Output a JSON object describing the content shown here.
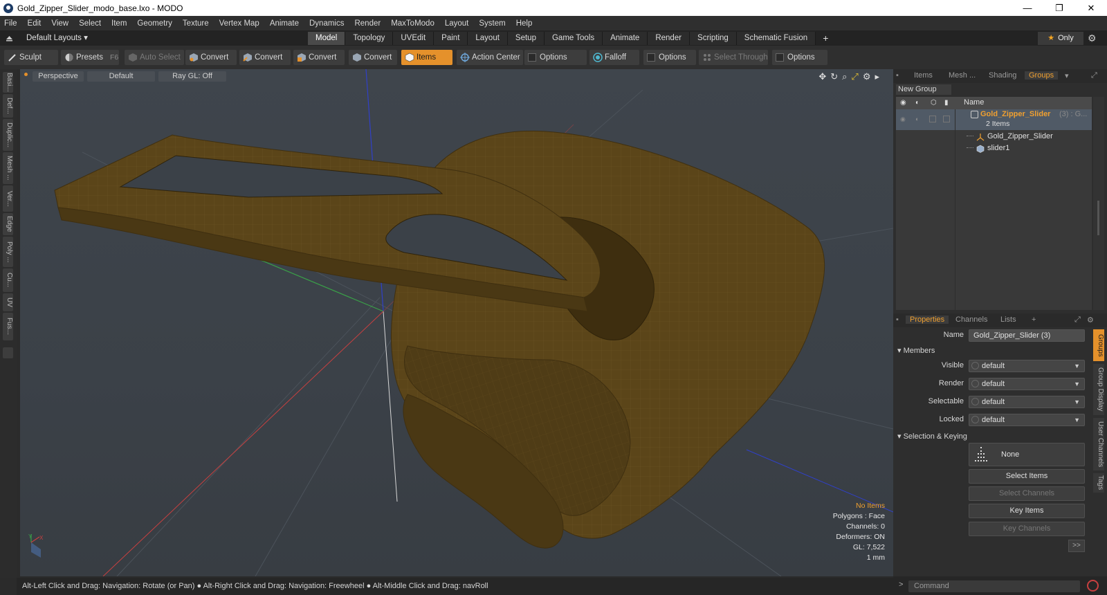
{
  "window": {
    "title": "Gold_Zipper_Slider_modo_base.lxo - MODO",
    "min": "—",
    "max": "❐",
    "close": "✕"
  },
  "menu": [
    "File",
    "Edit",
    "View",
    "Select",
    "Item",
    "Geometry",
    "Texture",
    "Vertex Map",
    "Animate",
    "Dynamics",
    "Render",
    "MaxToModo",
    "Layout",
    "System",
    "Help"
  ],
  "layout": {
    "selector": "Default Layouts ▾",
    "tabs": [
      "Model",
      "Topology",
      "UVEdit",
      "Paint",
      "Layout",
      "Setup",
      "Game Tools",
      "Animate",
      "Render",
      "Scripting",
      "Schematic Fusion"
    ],
    "active_tab": "Model",
    "plus": "+",
    "only": "Only"
  },
  "toolbar": {
    "sculpt": "Sculpt",
    "presets": "Presets",
    "presets_key": "F6",
    "auto_select": "Auto Select",
    "convert1": "Convert",
    "convert2": "Convert",
    "convert3": "Convert",
    "convert4": "Convert",
    "items": "Items",
    "action_center": "Action Center",
    "options1": "Options",
    "falloff": "Falloff",
    "options2": "Options",
    "select_through": "Select Through",
    "options3": "Options"
  },
  "left_tabs": [
    "Basi...",
    "Def...",
    "Duplic...",
    "Mesh ...",
    "Ver...",
    "Edge",
    "Poly ...",
    "Cu...",
    "UV",
    "Fus..."
  ],
  "viewport": {
    "view": "Perspective",
    "shading": "Default",
    "raygl": "Ray GL: Off",
    "info": {
      "no_items": "No Items",
      "polygons": "Polygons : Face",
      "channels": "Channels: 0",
      "deformers": "Deformers: ON",
      "gl": "GL: 7,522",
      "unit": "1 mm"
    },
    "colors": {
      "model": "#5b4519",
      "wire": "#6d5525",
      "x_axis": "#c84040",
      "y_axis": "#3aa048",
      "z_axis": "#3040c8"
    }
  },
  "status": "Alt-Left Click and Drag: Navigation: Rotate (or Pan) ● Alt-Right Click and Drag: Navigation: Freewheel ● Alt-Middle Click and Drag: navRoll",
  "groups_panel": {
    "tabs": [
      "Items",
      "Mesh ...",
      "Shading",
      "Groups"
    ],
    "active_tab": "Groups",
    "new_group": "New Group",
    "col_name": "Name",
    "group_name": "Gold_Zipper_Slider",
    "group_suffix": "(3) : G...",
    "group_count": "2 Items",
    "children": [
      "Gold_Zipper_Slider",
      "slider1"
    ]
  },
  "properties": {
    "tabs": [
      "Properties",
      "Channels",
      "Lists"
    ],
    "plus": "+",
    "name_label": "Name",
    "name_value": "Gold_Zipper_Slider (3)",
    "members_section": "Members",
    "fields": [
      {
        "label": "Visible",
        "value": "default"
      },
      {
        "label": "Render",
        "value": "default"
      },
      {
        "label": "Selectable",
        "value": "default"
      },
      {
        "label": "Locked",
        "value": "default"
      }
    ],
    "keying_section": "Selection & Keying",
    "none_label": "None",
    "select_items": "Select Items",
    "select_channels": "Select Channels",
    "key_items": "Key Items",
    "key_channels": "Key Channels",
    "more": ">>"
  },
  "right_vtabs": [
    "Groups",
    "Group Display",
    "User Channels",
    "Tags"
  ],
  "command_placeholder": "Command"
}
